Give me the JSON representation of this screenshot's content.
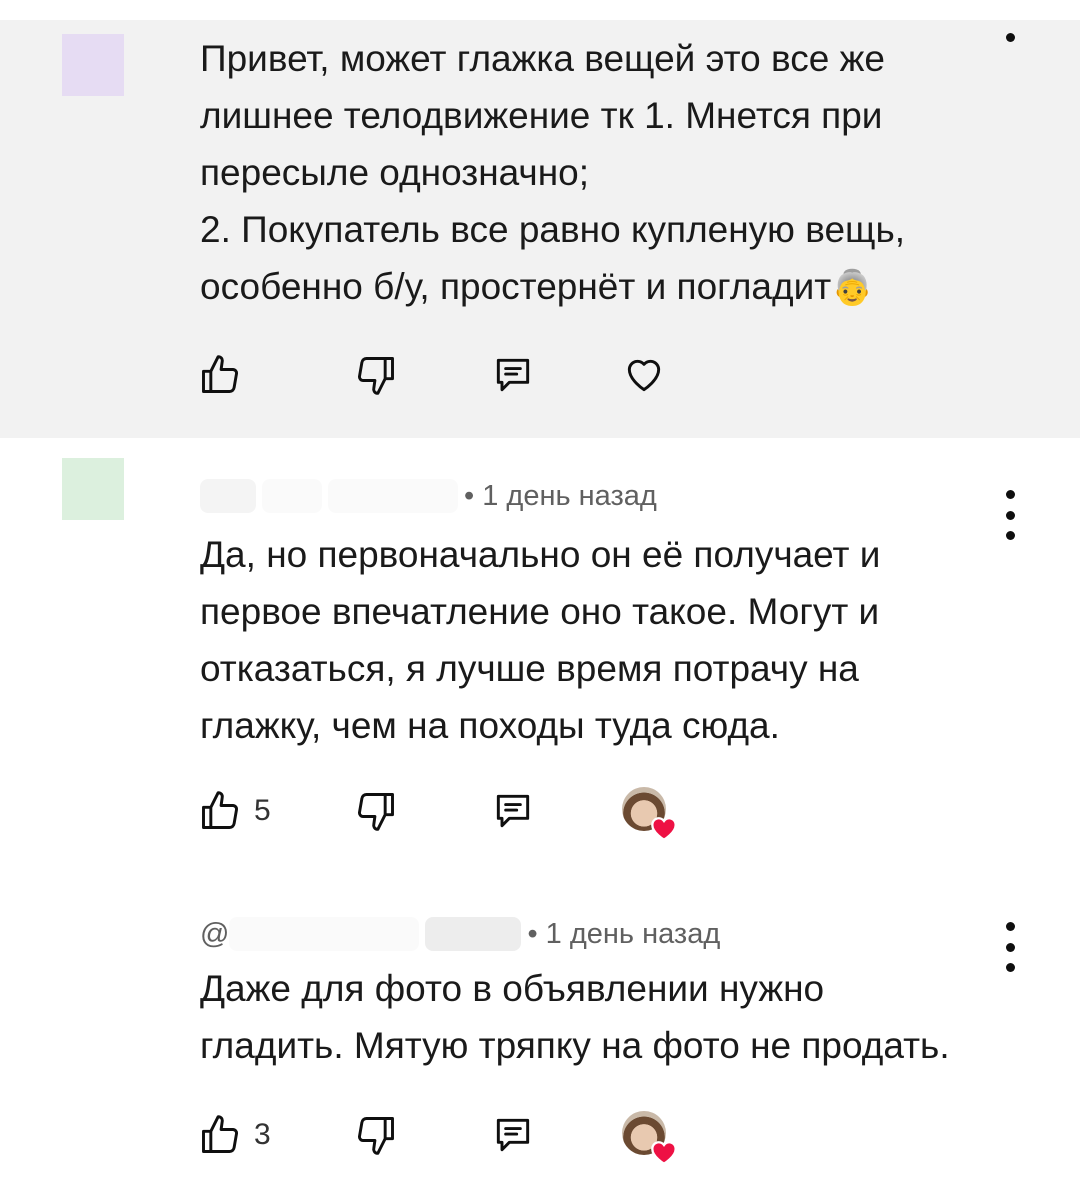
{
  "colors": {
    "highlight_bg": "#f2f2f2",
    "meta_text": "#606060",
    "heart": "#ee1144"
  },
  "comments": [
    {
      "text": "Привет, может глажка вещей это все же\nлишнее телодвижение тк  1. Мнется при\nпересыле однозначно;\n 2. Покупатель все равно купленую вещь,\nособенно б/у, простернёт и погладит",
      "emoji": "👵",
      "likes": "",
      "avatar_color": "#e6dcf3"
    },
    {
      "time": "• 1 день назад",
      "text": "Да, но первоначально он её получает и\nпервое впечатление оно такое.  Могут и\nотказаться, я лучше время потрачу на\nглажку,  чем на походы туда сюда.",
      "likes": "5",
      "avatar_color": "#dcf0de"
    },
    {
      "mention": "@",
      "time": "• 1 день назад",
      "text": "Даже для фото в объявлении нужно\nгладить. Мятую тряпку на фото не продать.",
      "likes": "3"
    }
  ],
  "icons": {
    "like": "thumbs-up-icon",
    "dislike": "thumbs-down-icon",
    "reply": "reply-icon",
    "heart": "heart-icon",
    "more": "more-vert-icon"
  }
}
